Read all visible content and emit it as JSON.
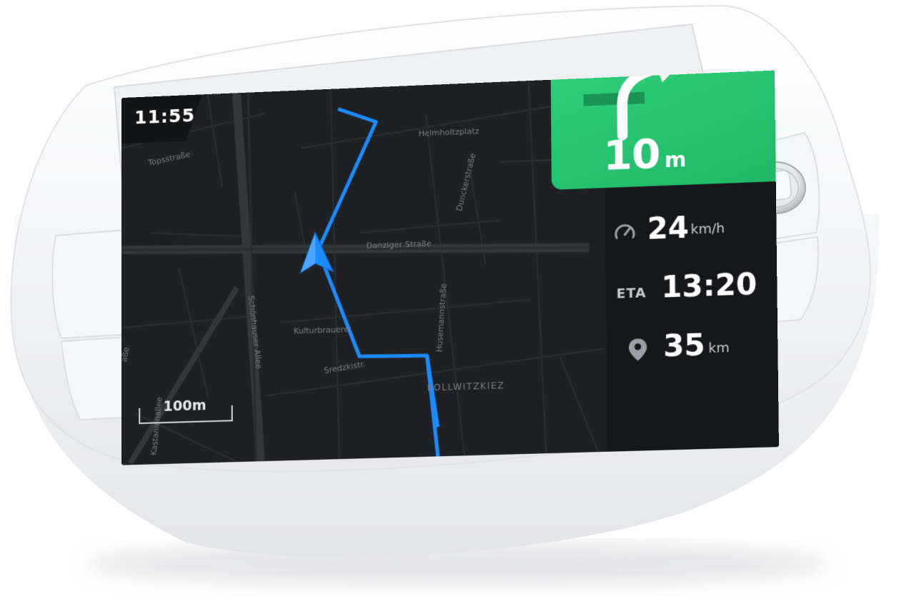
{
  "status": {
    "time": "11:55"
  },
  "navigation": {
    "distance_value": "10",
    "distance_unit": "m",
    "maneuver_icon": "turn-right-arrow-icon",
    "accent_color": "#2ac872"
  },
  "stats": {
    "speed_value": "24",
    "speed_unit": "km/h",
    "eta_label": "ETA",
    "eta_value": "13:20",
    "distance_value": "35",
    "distance_unit": "km"
  },
  "map": {
    "scale_label": "100m",
    "route_color": "#1a8cff",
    "streets": [
      "Helmholtzplatz",
      "Topsstraße",
      "Dunckerstraße",
      "Danziger Straße",
      "Schönhauser Allee",
      "Kulturbrauerei",
      "Sredzkistr.",
      "Husemannstraße",
      "KOLLWITZKIEZ",
      "Kastanienallee",
      "aße"
    ]
  }
}
